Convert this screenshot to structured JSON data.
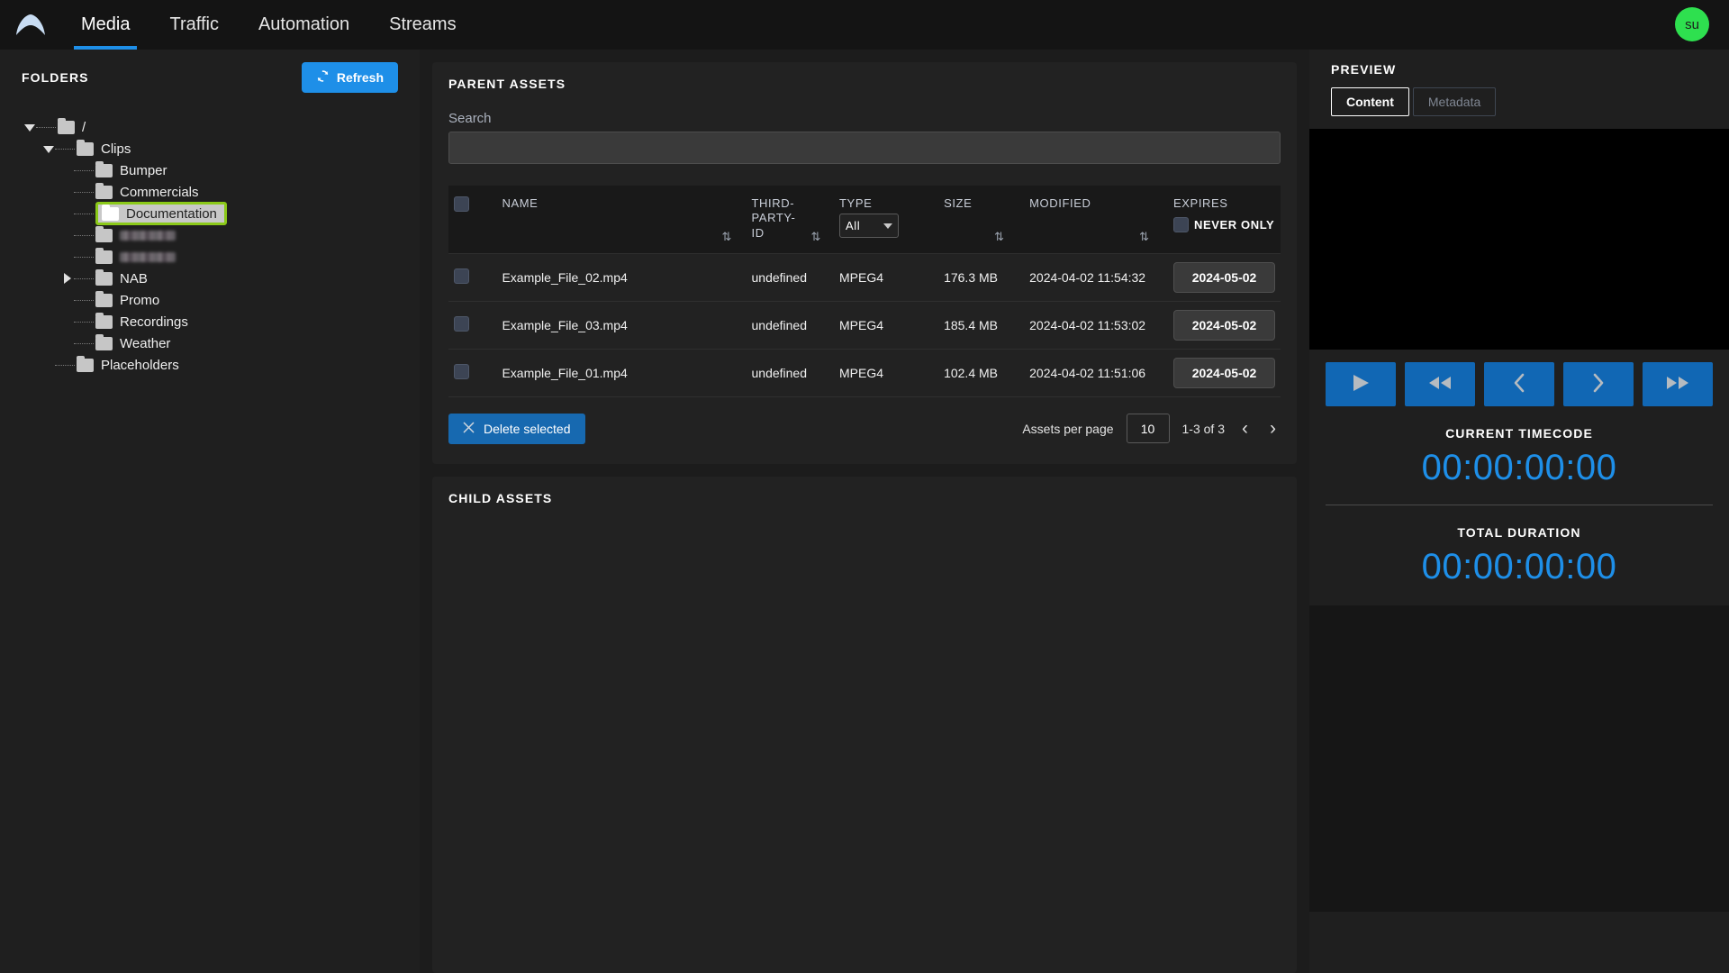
{
  "nav": {
    "logo_icon": "app-logo-icon",
    "tabs": [
      {
        "label": "Media",
        "active": true
      },
      {
        "label": "Traffic",
        "active": false
      },
      {
        "label": "Automation",
        "active": false
      },
      {
        "label": "Streams",
        "active": false
      }
    ],
    "avatar_initials": "su",
    "avatar_color": "#2ee04f"
  },
  "sidebar": {
    "title": "FOLDERS",
    "refresh_label": "Refresh",
    "refresh_icon": "refresh-icon",
    "tree": [
      {
        "label": "/",
        "depth": 0,
        "twist": "down",
        "state": "normal"
      },
      {
        "label": "Clips",
        "depth": 1,
        "twist": "down",
        "state": "normal"
      },
      {
        "label": "Bumper",
        "depth": 2,
        "twist": "none",
        "state": "normal"
      },
      {
        "label": "Commercials",
        "depth": 2,
        "twist": "none",
        "state": "normal"
      },
      {
        "label": "Documentation",
        "depth": 2,
        "twist": "none",
        "state": "selected"
      },
      {
        "label": "",
        "depth": 2,
        "twist": "none",
        "state": "redacted"
      },
      {
        "label": "",
        "depth": 2,
        "twist": "none",
        "state": "redacted"
      },
      {
        "label": "NAB",
        "depth": 2,
        "twist": "right",
        "state": "normal"
      },
      {
        "label": "Promo",
        "depth": 2,
        "twist": "none",
        "state": "normal"
      },
      {
        "label": "Recordings",
        "depth": 2,
        "twist": "none",
        "state": "normal"
      },
      {
        "label": "Weather",
        "depth": 2,
        "twist": "none",
        "state": "normal"
      },
      {
        "label": "Placeholders",
        "depth": 1,
        "twist": "none",
        "state": "normal"
      }
    ]
  },
  "parent_assets": {
    "title": "PARENT ASSETS",
    "search_label": "Search",
    "search_value": "",
    "search_placeholder": "",
    "columns": [
      {
        "key": "select",
        "label": ""
      },
      {
        "key": "name",
        "label": "NAME",
        "sortable": true
      },
      {
        "key": "third_party_id",
        "label": "THIRD-PARTY-ID",
        "sortable": true
      },
      {
        "key": "type",
        "label": "TYPE",
        "sortable": false
      },
      {
        "key": "size",
        "label": "SIZE",
        "sortable": true
      },
      {
        "key": "modified",
        "label": "MODIFIED",
        "sortable": true
      },
      {
        "key": "expires",
        "label": "EXPIRES",
        "sortable": false
      }
    ],
    "type_filter_value": "All",
    "never_only_label": "NEVER ONLY",
    "sort_icon": "sort-updown-icon",
    "rows": [
      {
        "name": "Example_File_02.mp4",
        "third_party_id": "undefined",
        "type": "MPEG4",
        "size": "176.3 MB",
        "modified": "2024-04-02 11:54:32",
        "expires": "2024-05-02"
      },
      {
        "name": "Example_File_03.mp4",
        "third_party_id": "undefined",
        "type": "MPEG4",
        "size": "185.4 MB",
        "modified": "2024-04-02 11:53:02",
        "expires": "2024-05-02"
      },
      {
        "name": "Example_File_01.mp4",
        "third_party_id": "undefined",
        "type": "MPEG4",
        "size": "102.4 MB",
        "modified": "2024-04-02 11:51:06",
        "expires": "2024-05-02"
      }
    ],
    "delete_label": "Delete selected",
    "delete_icon": "close-x-icon",
    "per_page_label": "Assets per page",
    "per_page_value": "10",
    "range_label": "1-3 of 3",
    "prev_icon": "chevron-left-icon",
    "next_icon": "chevron-right-icon"
  },
  "child_assets": {
    "title": "CHILD ASSETS"
  },
  "preview": {
    "title": "PREVIEW",
    "tabs": [
      {
        "label": "Content",
        "active": true
      },
      {
        "label": "Metadata",
        "active": false
      }
    ],
    "transport": [
      {
        "name": "play-button",
        "icon": "play-icon"
      },
      {
        "name": "rewind-button",
        "icon": "rewind-icon"
      },
      {
        "name": "step-back-button",
        "icon": "chevron-left-icon"
      },
      {
        "name": "step-forward-button",
        "icon": "chevron-right-icon"
      },
      {
        "name": "fast-forward-button",
        "icon": "fast-forward-icon"
      }
    ],
    "current_timecode_label": "CURRENT TIMECODE",
    "current_timecode_value": "00:00:00:00",
    "total_duration_label": "TOTAL DURATION",
    "total_duration_value": "00:00:00:00",
    "accent_color": "#1e8fe8"
  }
}
